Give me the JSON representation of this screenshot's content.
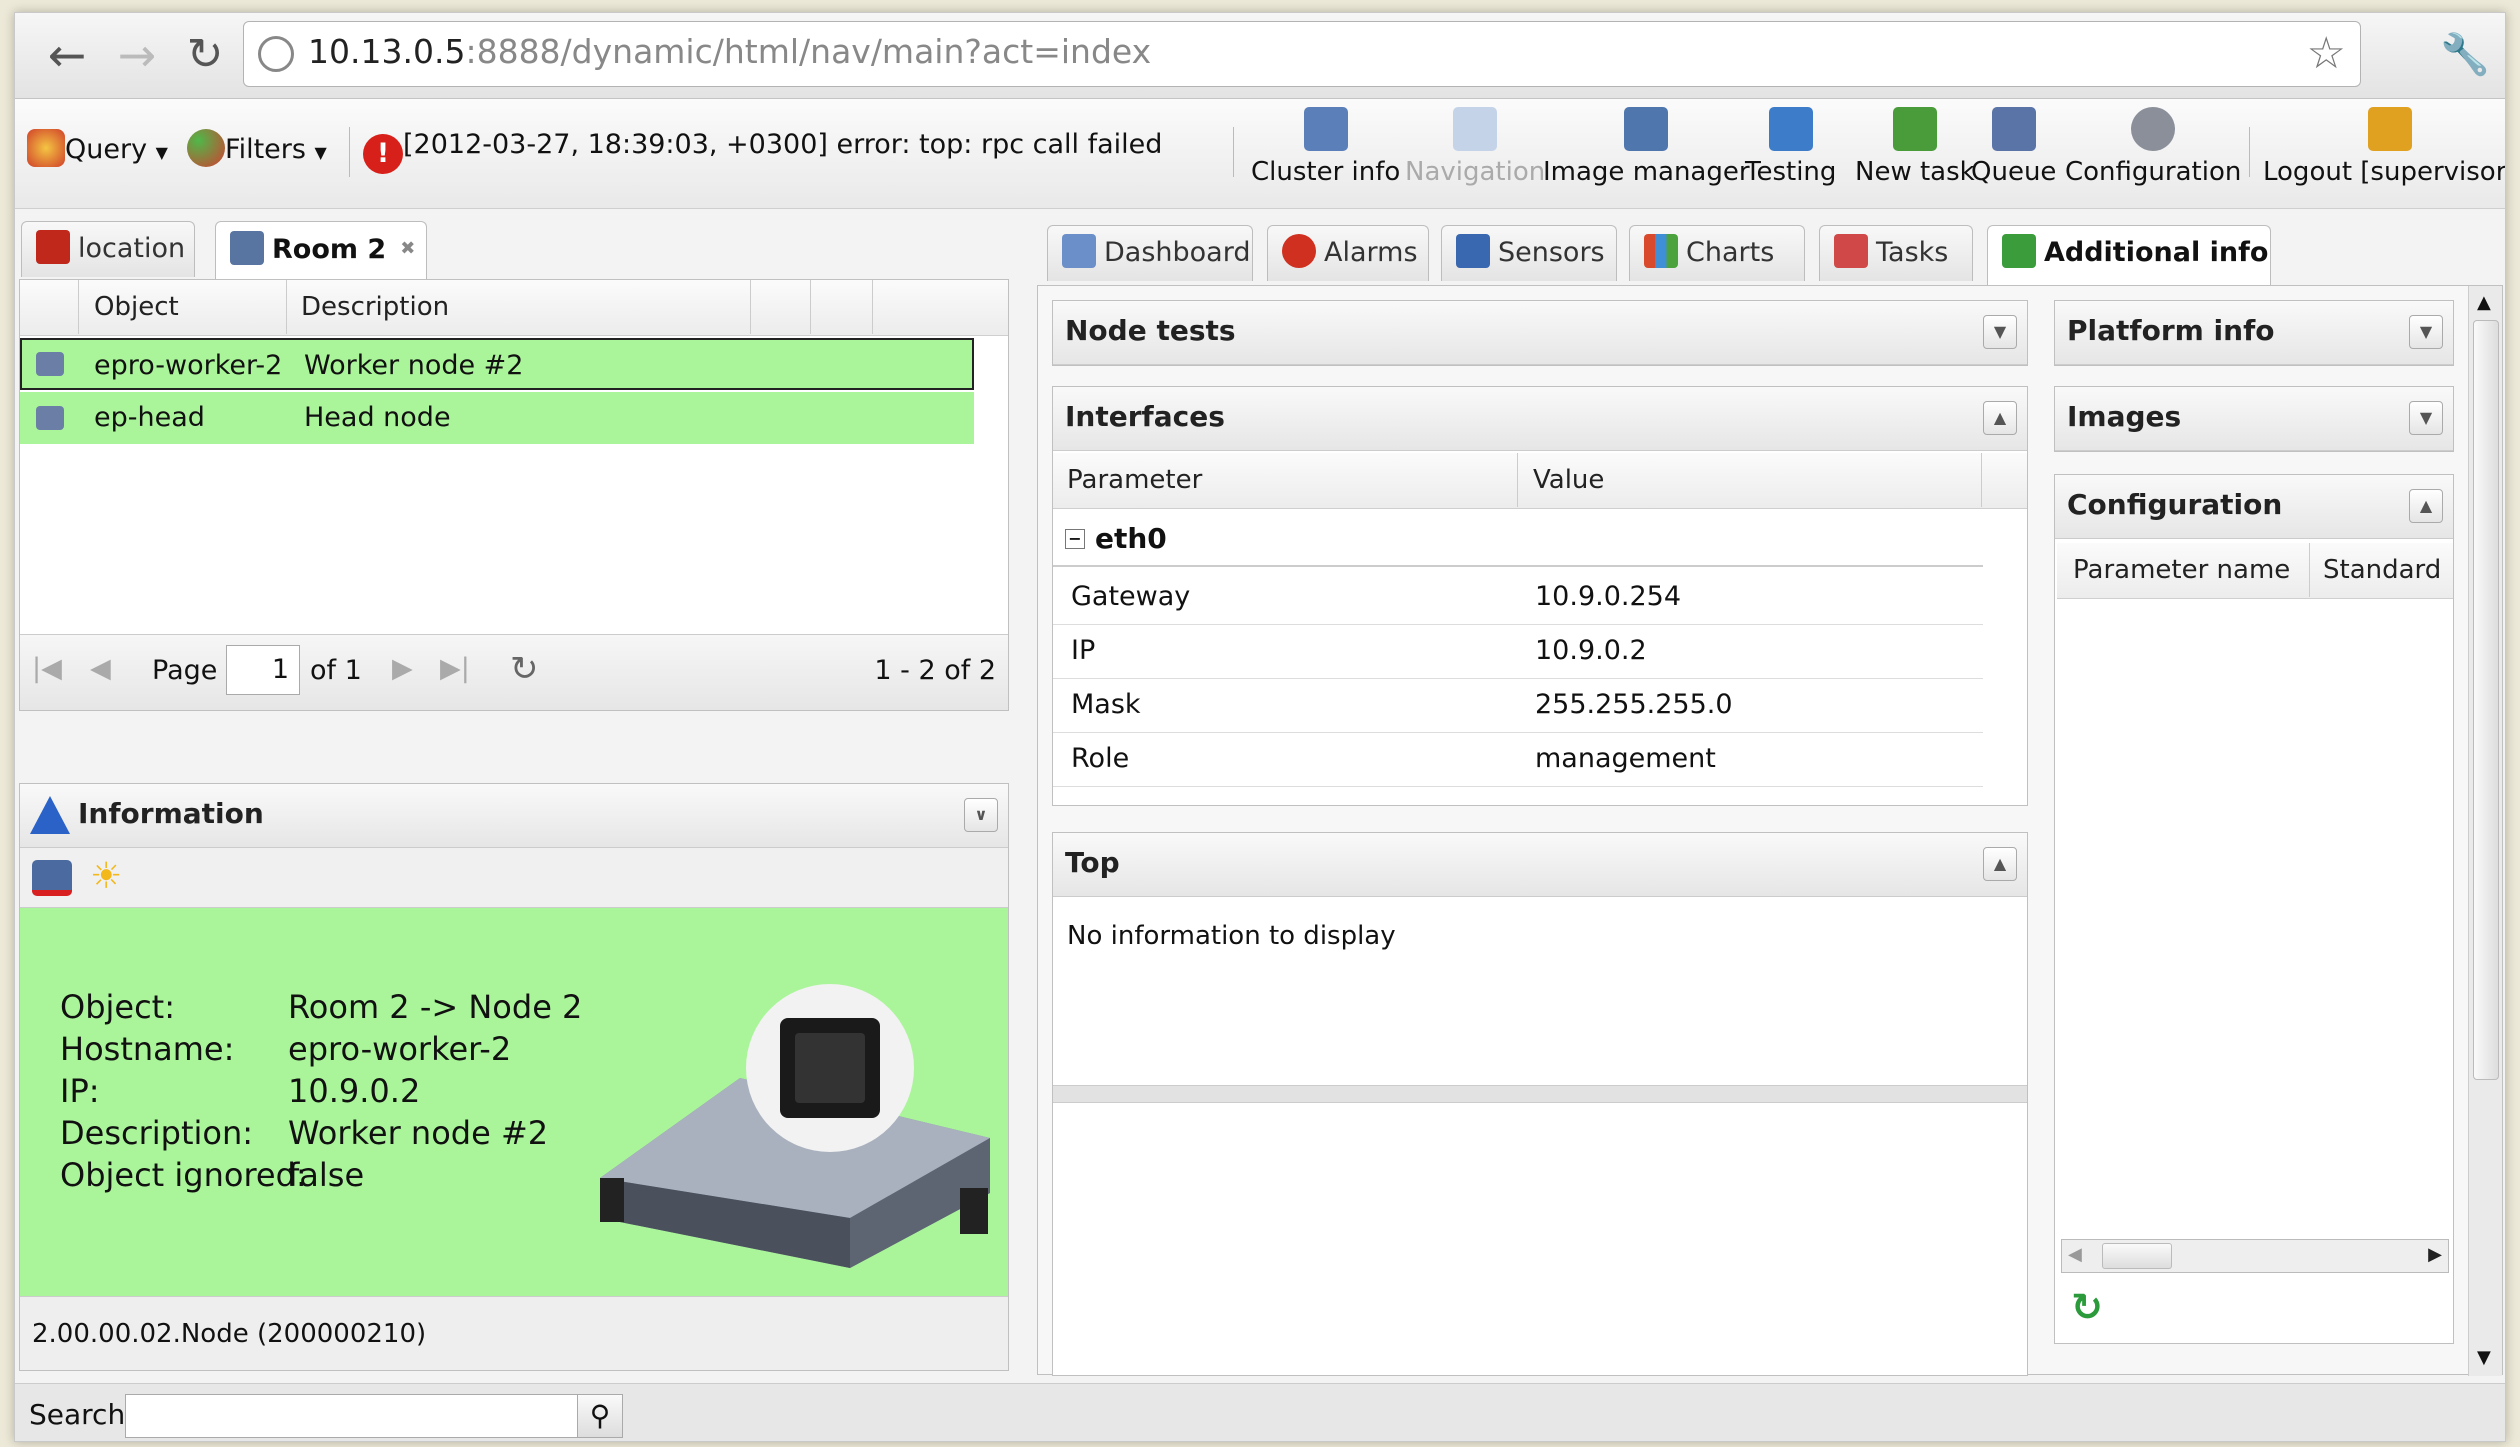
{
  "browser": {
    "url_host": "10.13.0.5",
    "url_rest": ":8888/dynamic/html/nav/main?act=index"
  },
  "toolbar": {
    "query_label": "Query",
    "filters_label": "Filters",
    "error_message": "[2012-03-27, 18:39:03, +0300] error: top: rpc call failed",
    "buttons": [
      {
        "label": "Cluster info",
        "icon": "cluster-info-icon",
        "color": "#5b7fb8"
      },
      {
        "label": "Navigation",
        "icon": "navigation-icon",
        "color": "#9ab4d8"
      },
      {
        "label": "Image manager",
        "icon": "image-manager-icon",
        "color": "#4f76ad"
      },
      {
        "label": "Testing",
        "icon": "testing-icon",
        "color": "#3c7cc8"
      },
      {
        "label": "New task",
        "icon": "new-task-icon",
        "color": "#4a9b3a"
      },
      {
        "label": "Queue",
        "icon": "queue-icon",
        "color": "#5a74a8"
      },
      {
        "label": "Configuration",
        "icon": "configuration-icon",
        "color": "#8a8f99"
      },
      {
        "label": "Logout [supervisor]",
        "icon": "logout-icon",
        "color": "#e0a020"
      }
    ]
  },
  "left": {
    "tabs": [
      {
        "label": "location"
      },
      {
        "label": "Room 2"
      }
    ],
    "columns": [
      "Object",
      "Description"
    ],
    "rows": [
      {
        "object": "epro-worker-2",
        "description": "Worker node #2"
      },
      {
        "object": "ep-head",
        "description": "Head node"
      }
    ],
    "pager": {
      "page_label": "Page",
      "page_value": "1",
      "of_label": "of 1",
      "range": "1 - 2 of 2"
    }
  },
  "info": {
    "title": "Information",
    "fields": [
      {
        "label": "Object:",
        "value": "Room 2 -> Node 2"
      },
      {
        "label": "Hostname:",
        "value": "epro-worker-2"
      },
      {
        "label": "IP:",
        "value": "10.9.0.2"
      },
      {
        "label": "Description:",
        "value": "Worker node #2"
      },
      {
        "label": "Object ignored:",
        "value": "false"
      }
    ],
    "footer": "2.00.00.02.Node (200000210)",
    "bg_color": "#aaf59a"
  },
  "search": {
    "label": "Search",
    "value": ""
  },
  "right": {
    "tabs": [
      {
        "label": "Dashboard"
      },
      {
        "label": "Alarms"
      },
      {
        "label": "Sensors"
      },
      {
        "label": "Charts"
      },
      {
        "label": "Tasks"
      },
      {
        "label": "Additional info"
      }
    ],
    "node_tests_title": "Node tests",
    "interfaces": {
      "title": "Interfaces",
      "columns": [
        "Parameter",
        "Value"
      ],
      "group": "eth0",
      "rows": [
        {
          "param": "Gateway",
          "value": "10.9.0.254"
        },
        {
          "param": "IP",
          "value": "10.9.0.2"
        },
        {
          "param": "Mask",
          "value": "255.255.255.0"
        },
        {
          "param": "Role",
          "value": "management"
        }
      ]
    },
    "top": {
      "title": "Top",
      "empty_text": "No information to display"
    },
    "platform_info_title": "Platform info",
    "images_title": "Images",
    "configuration": {
      "title": "Configuration",
      "columns": [
        "Parameter name",
        "Standard"
      ]
    }
  }
}
